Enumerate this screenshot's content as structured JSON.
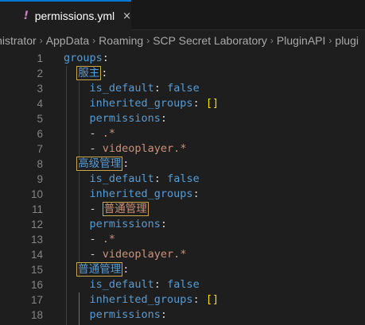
{
  "tab": {
    "icon": "!",
    "filename": "permissions.yml",
    "close": "×"
  },
  "breadcrumb": [
    "inistrator",
    "AppData",
    "Roaming",
    "SCP Secret Laboratory",
    "PluginAPI",
    "plugi"
  ],
  "editor": {
    "lines": [
      {
        "n": "1",
        "tokens": [
          {
            "t": "groups",
            "c": "key"
          },
          {
            "t": ":",
            "c": "punc"
          }
        ]
      },
      {
        "n": "2",
        "tokens": [
          {
            "t": "  "
          },
          {
            "t": "服主",
            "c": "key",
            "box": true
          },
          {
            "t": ":",
            "c": "punc"
          }
        ]
      },
      {
        "n": "3",
        "tokens": [
          {
            "t": "    "
          },
          {
            "t": "is_default",
            "c": "key"
          },
          {
            "t": ": ",
            "c": "punc"
          },
          {
            "t": "false",
            "c": "bool"
          }
        ]
      },
      {
        "n": "4",
        "tokens": [
          {
            "t": "    "
          },
          {
            "t": "inherited_groups",
            "c": "key"
          },
          {
            "t": ": ",
            "c": "punc"
          },
          {
            "t": "[]",
            "c": "bracket"
          }
        ]
      },
      {
        "n": "5",
        "tokens": [
          {
            "t": "    "
          },
          {
            "t": "permissions",
            "c": "key"
          },
          {
            "t": ":",
            "c": "punc"
          }
        ]
      },
      {
        "n": "6",
        "tokens": [
          {
            "t": "    "
          },
          {
            "t": "- ",
            "c": "dash"
          },
          {
            "t": ".*",
            "c": "str"
          }
        ]
      },
      {
        "n": "7",
        "tokens": [
          {
            "t": "    "
          },
          {
            "t": "- ",
            "c": "dash"
          },
          {
            "t": "videoplayer.*",
            "c": "str"
          }
        ]
      },
      {
        "n": "8",
        "tokens": [
          {
            "t": "  "
          },
          {
            "t": "高级管理",
            "c": "key",
            "box": true
          },
          {
            "t": ":",
            "c": "punc"
          }
        ]
      },
      {
        "n": "9",
        "tokens": [
          {
            "t": "    "
          },
          {
            "t": "is_default",
            "c": "key"
          },
          {
            "t": ": ",
            "c": "punc"
          },
          {
            "t": "false",
            "c": "bool"
          }
        ]
      },
      {
        "n": "10",
        "tokens": [
          {
            "t": "    "
          },
          {
            "t": "inherited_groups",
            "c": "key"
          },
          {
            "t": ":",
            "c": "punc"
          }
        ]
      },
      {
        "n": "11",
        "tokens": [
          {
            "t": "    "
          },
          {
            "t": "- ",
            "c": "dash"
          },
          {
            "t": "普通管理",
            "c": "str",
            "box": true
          }
        ]
      },
      {
        "n": "12",
        "tokens": [
          {
            "t": "    "
          },
          {
            "t": "permissions",
            "c": "key"
          },
          {
            "t": ":",
            "c": "punc"
          }
        ]
      },
      {
        "n": "13",
        "tokens": [
          {
            "t": "    "
          },
          {
            "t": "- ",
            "c": "dash"
          },
          {
            "t": ".*",
            "c": "str"
          }
        ]
      },
      {
        "n": "14",
        "tokens": [
          {
            "t": "    "
          },
          {
            "t": "- ",
            "c": "dash"
          },
          {
            "t": "videoplayer.*",
            "c": "str"
          }
        ]
      },
      {
        "n": "15",
        "tokens": [
          {
            "t": "  "
          },
          {
            "t": "普通管理",
            "c": "key",
            "box": true
          },
          {
            "t": ":",
            "c": "punc"
          }
        ]
      },
      {
        "n": "16",
        "tokens": [
          {
            "t": "    "
          },
          {
            "t": "is_default",
            "c": "key"
          },
          {
            "t": ": ",
            "c": "punc"
          },
          {
            "t": "false",
            "c": "bool"
          }
        ]
      },
      {
        "n": "17",
        "tokens": [
          {
            "t": "    "
          },
          {
            "t": "inherited_groups",
            "c": "key"
          },
          {
            "t": ": ",
            "c": "punc"
          },
          {
            "t": "[]",
            "c": "bracket"
          }
        ]
      },
      {
        "n": "18",
        "tokens": [
          {
            "t": "    "
          },
          {
            "t": "permissions",
            "c": "key"
          },
          {
            "t": ":",
            "c": "punc"
          }
        ]
      }
    ]
  },
  "colors": {
    "key": "#569cd6",
    "string": "#ce9178",
    "bracket": "#ffd700",
    "accent": "#0078d4"
  }
}
